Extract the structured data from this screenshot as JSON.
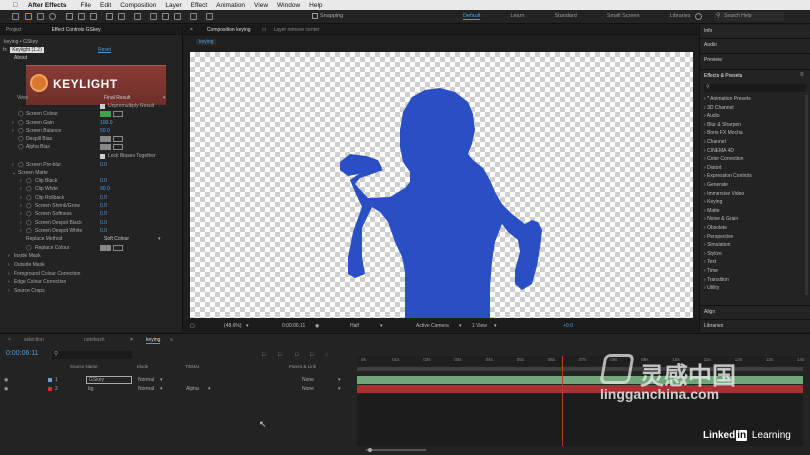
{
  "menubar": {
    "app": "After Effects",
    "items": [
      "File",
      "Edit",
      "Composition",
      "Layer",
      "Effect",
      "Animation",
      "View",
      "Window",
      "Help"
    ]
  },
  "toolbar": {
    "snapping": "Snapping",
    "workspaces": [
      "Default",
      "Learn",
      "Standard",
      "Small Screen",
      "Libraries"
    ],
    "search_placeholder": "Search Help"
  },
  "left_panel": {
    "tabs": [
      "Project",
      "Effect Controls GSkey"
    ],
    "breadcrumb": "keying • GSkey",
    "effect_name": "Keylight (1.2)",
    "reset": "Reset",
    "about": "About",
    "logo_text": "KEYLIGHT",
    "view_label": "View",
    "view_value": "Final Result",
    "unpremultiply": "Unpremultiply Result",
    "params": [
      {
        "label": "Screen Colour",
        "value": ""
      },
      {
        "label": "Screen Gain",
        "value": "100.0"
      },
      {
        "label": "Screen Balance",
        "value": "50.0"
      },
      {
        "label": "Despill Bias",
        "value": ""
      },
      {
        "label": "Alpha Bias",
        "value": ""
      }
    ],
    "lock_biases": "Lock Biases Together",
    "screen_preblur": {
      "label": "Screen Pre-blur",
      "value": "0.0"
    },
    "screen_matte": "Screen Matte",
    "matte_params": [
      {
        "label": "Clip Black",
        "value": "0.0"
      },
      {
        "label": "Clip White",
        "value": "90.0"
      },
      {
        "label": "Clip Rollback",
        "value": "0.0"
      },
      {
        "label": "Screen Shrink/Grow",
        "value": "0.0"
      },
      {
        "label": "Screen Softness",
        "value": "0.0"
      },
      {
        "label": "Screen Despot Black",
        "value": "0.0"
      },
      {
        "label": "Screen Despot White",
        "value": "0.0"
      }
    ],
    "replace_method": {
      "label": "Replace Method",
      "value": "Soft Colour"
    },
    "replace_colour": "Replace Colour",
    "groups": [
      "Inside Mask",
      "Outside Mask",
      "Foreground Colour Correction",
      "Edge Colour Correction",
      "Source Crops"
    ]
  },
  "comp_panel": {
    "tab": "Composition keying",
    "layer_tab": "Layer remove center",
    "sub_tab": "keying",
    "footer": {
      "zoom": "(48.6%)",
      "timecode": "0:00:06:11",
      "resolution": "Half",
      "camera": "Active Camera",
      "views": "1 View",
      "exposure": "+0.0"
    }
  },
  "right_panel": {
    "sections": [
      "Info",
      "Audio",
      "Preview"
    ],
    "effects_title": "Effects & Presets",
    "effects": [
      "* Animation Presets",
      "3D Channel",
      "Audio",
      "Blur & Sharpen",
      "Boris FX Mocha",
      "Channel",
      "CINEMA 4D",
      "Color Correction",
      "Distort",
      "Expression Controls",
      "Generate",
      "Immersive Video",
      "Keying",
      "Matte",
      "Noise & Grain",
      "Obsolete",
      "Perspective",
      "Simulation",
      "Stylize",
      "Text",
      "Time",
      "Transition",
      "Utility"
    ],
    "bottom": [
      "Align",
      "Libraries"
    ]
  },
  "timeline": {
    "tabs": [
      "selection",
      "notebush",
      "keying"
    ],
    "timecode": "0:00:06:11",
    "columns": {
      "name": "Source Name",
      "mode": "Mode",
      "trkmat": "TrkMat",
      "parent": "Parent & Link"
    },
    "layers": [
      {
        "num": "1",
        "name": "GSkey",
        "mode": "Normal",
        "trkmat": "",
        "parent": "None",
        "color": "#6e9bd8"
      },
      {
        "num": "2",
        "name": "bg",
        "mode": "Normal",
        "trkmat": "Alpha",
        "parent": "None",
        "color": "#c0392b"
      }
    ],
    "ruler": [
      "0s",
      "01s",
      "02s",
      "03s",
      "04s",
      "05s",
      "06s",
      "07s",
      "08s",
      "09s",
      "10s",
      "11s",
      "12s",
      "13s",
      "14s"
    ],
    "playhead_fraction": 0.46
  },
  "watermark": {
    "brand": "灵感中国",
    "url": "lingganchina.com"
  },
  "linkedin": {
    "text": "Linked",
    "in": "in",
    "learning": "Learning"
  },
  "colors": {
    "accent": "#4a9ee8",
    "silhouette": "#2a4fc4",
    "green_bar": "#6fa67a",
    "red_bar": "#a83232",
    "playhead": "#c0392b"
  }
}
